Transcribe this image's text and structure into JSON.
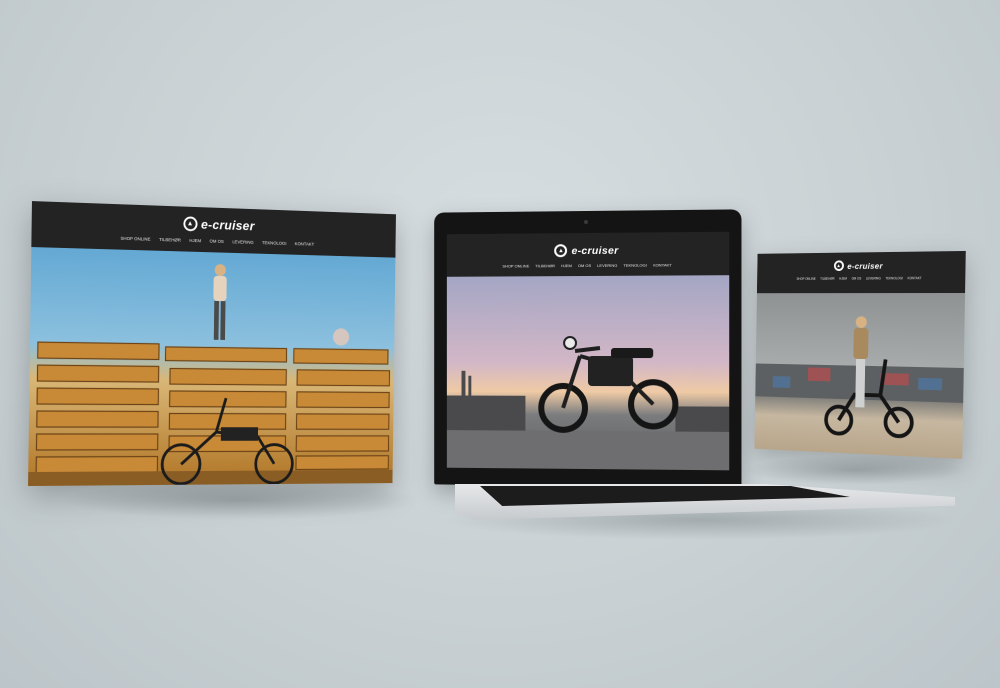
{
  "site": {
    "brand": "e-cruiser",
    "logo_icon": "mountain-in-circle-icon",
    "colors": {
      "header": "#232323",
      "background": "#c9d1d4"
    }
  },
  "nav_left": [
    "SHOP ONLINE",
    "TILBEHØR",
    "HJEM",
    "OM OS",
    "LEVERING",
    "TEKNOLOGI",
    "KONTAKT"
  ],
  "nav_mid": [
    "SHOP ONLINE",
    "TILBEHØR",
    "HJEM",
    "OM OS",
    "LEVERING",
    "TEKNOLOGI",
    "KONTAKT"
  ],
  "nav_right": [
    "SHOP ONLINE",
    "TILBEHØR",
    "HJEM",
    "OM OS",
    "LEVERING",
    "TEKNOLOGI",
    "KONTAKT"
  ],
  "photos": {
    "left": "woman-on-pallets-with-ebike",
    "middle": "ebike-at-sunset",
    "right": "woman-on-ebike-by-wall"
  }
}
